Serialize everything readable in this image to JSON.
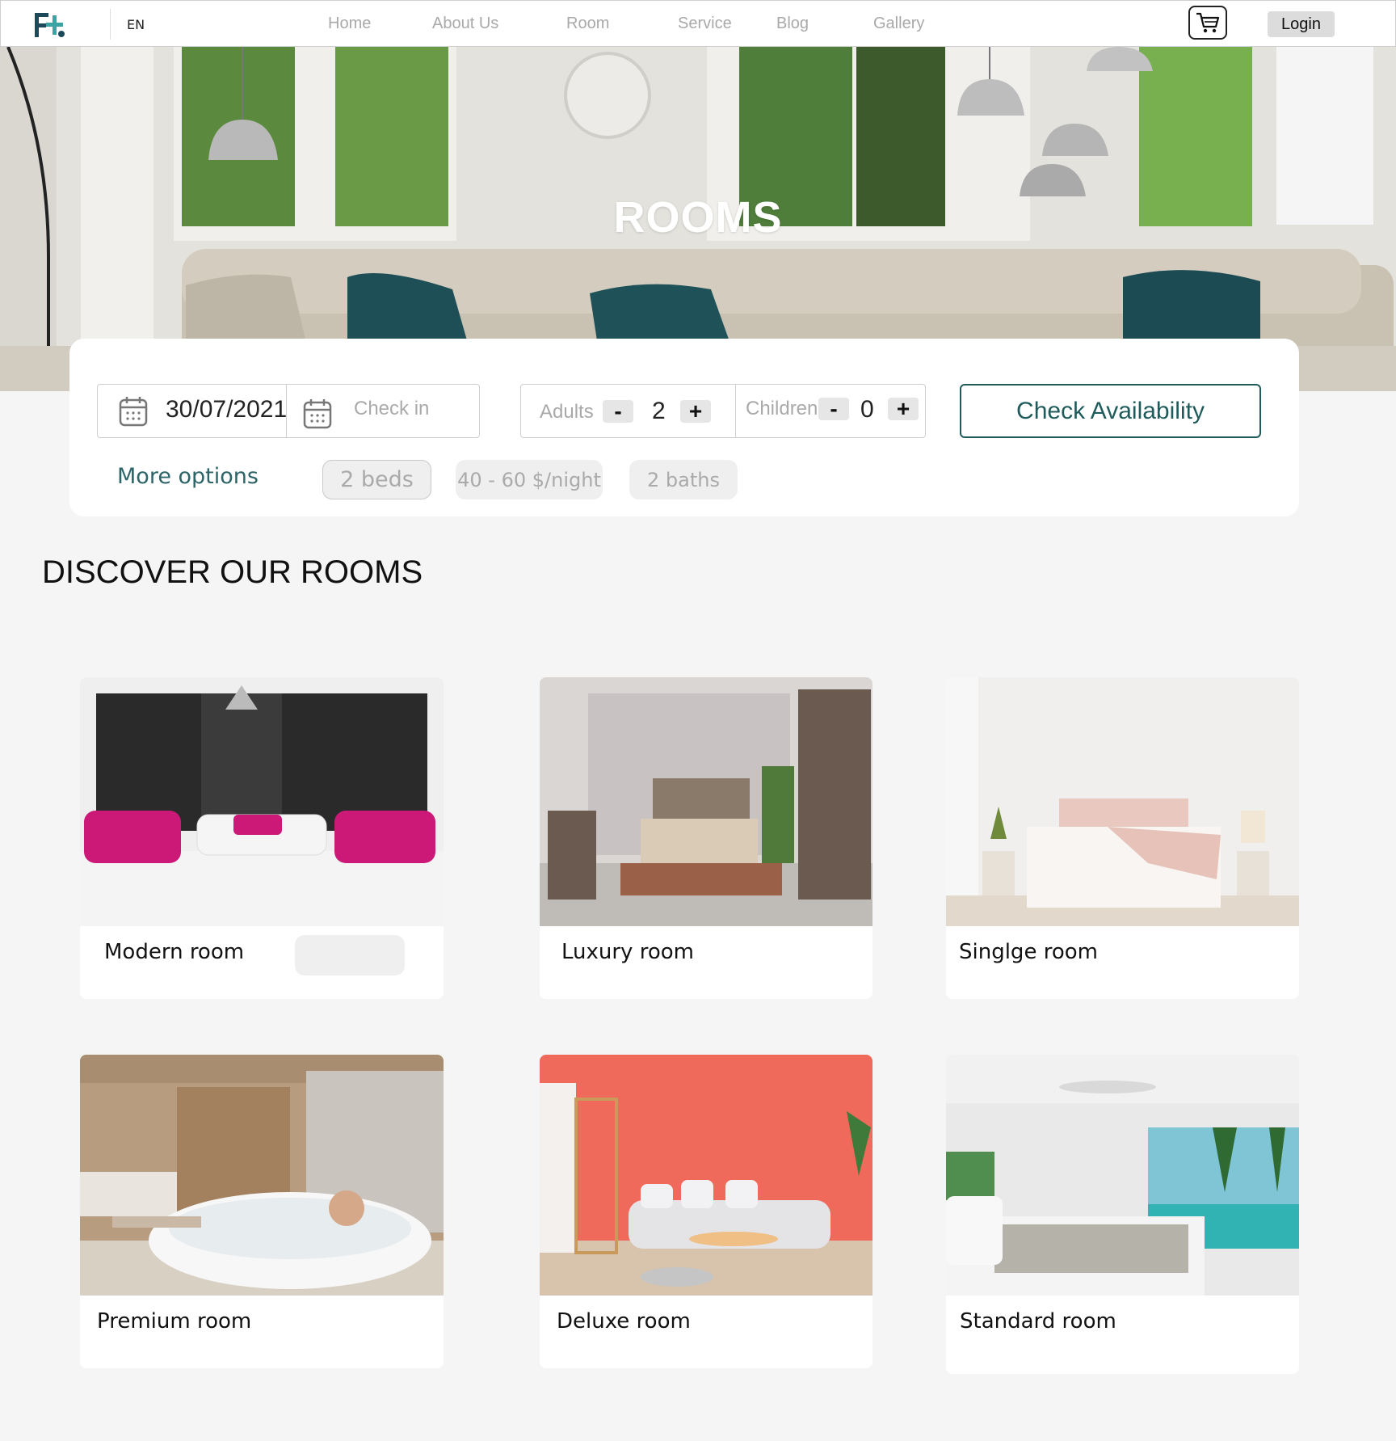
{
  "header": {
    "language": "EN",
    "nav": [
      "Home",
      "About Us",
      "Room",
      "Service",
      "Blog",
      "Gallery"
    ],
    "login_label": "Login",
    "cart_icon": "shopping-cart-icon"
  },
  "hero": {
    "title": "ROOMS"
  },
  "search": {
    "date_value": "30/07/2021",
    "checkin_placeholder": "Check in",
    "adults_label": "Adults",
    "adults_value": "2",
    "children_label": "Children",
    "children_value": "0",
    "minus": "-",
    "plus": "+",
    "check_label": "Check Availability",
    "more_options": "More options",
    "filters": [
      "2 beds",
      "40 - 60 $/night",
      "2 baths"
    ]
  },
  "section": {
    "title": "DISCOVER OUR ROOMS"
  },
  "rooms": [
    {
      "name": "Modern room"
    },
    {
      "name": "Luxury room"
    },
    {
      "name": "Singlge room"
    },
    {
      "name": "Premium room"
    },
    {
      "name": "Deluxe room"
    },
    {
      "name": "Standard room"
    }
  ],
  "colors": {
    "accent": "#1f5b5b",
    "link": "#2c6468",
    "muted": "#a9a9a9",
    "background": "#f5f5f5"
  }
}
